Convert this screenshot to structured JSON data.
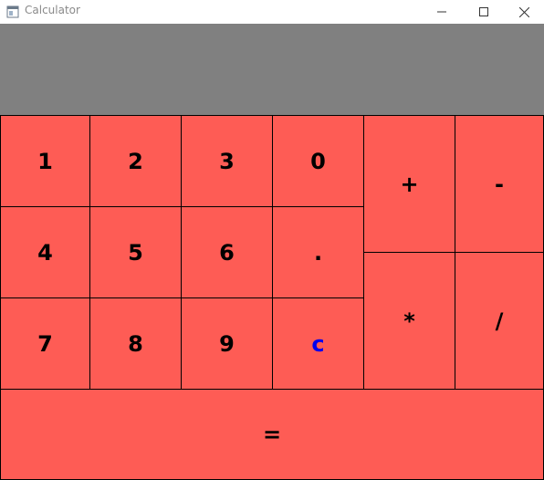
{
  "window": {
    "title": "Calculator",
    "icon": "app-window-icon",
    "controls": [
      "minimize-icon",
      "maximize-icon",
      "close-icon"
    ]
  },
  "display": {
    "value": ""
  },
  "keys": {
    "k1": "1",
    "k2": "2",
    "k3": "3",
    "k0": "0",
    "k4": "4",
    "k5": "5",
    "k6": "6",
    "kdot": ".",
    "k7": "7",
    "k8": "8",
    "k9": "9",
    "kc": "c",
    "kplus": "+",
    "kminus": "-",
    "kmul": "*",
    "kdiv": "/",
    "keq": "="
  },
  "colors": {
    "key_background": "#fe5c55",
    "display_background": "#808080",
    "clear_text": "#0000ee",
    "key_text": "#000000"
  }
}
